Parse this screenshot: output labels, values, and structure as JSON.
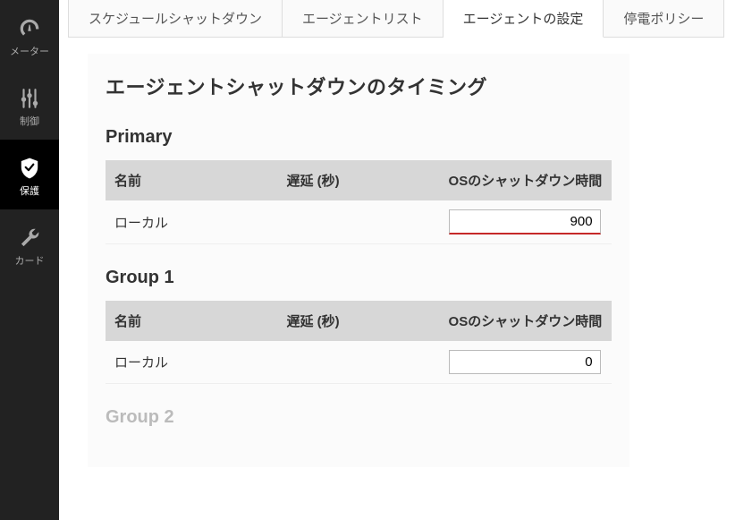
{
  "sidebar": {
    "items": [
      {
        "label": "メーター",
        "name": "sidebar-item-meter",
        "icon": "gauge-icon",
        "active": false
      },
      {
        "label": "制御",
        "name": "sidebar-item-control",
        "icon": "sliders-icon",
        "active": false
      },
      {
        "label": "保護",
        "name": "sidebar-item-protect",
        "icon": "shield-icon",
        "active": true
      },
      {
        "label": "カード",
        "name": "sidebar-item-card",
        "icon": "wrench-icon",
        "active": false
      }
    ]
  },
  "tabs": [
    {
      "label": "スケジュールシャットダウン",
      "name": "tab-scheduled-shutdown",
      "active": false
    },
    {
      "label": "エージェントリスト",
      "name": "tab-agent-list",
      "active": false
    },
    {
      "label": "エージェントの設定",
      "name": "tab-agent-settings",
      "active": true
    },
    {
      "label": "停電ポリシー",
      "name": "tab-outage-policy",
      "active": false
    }
  ],
  "panel": {
    "title": "エージェントシャットダウンのタイミング",
    "columns": {
      "name": "名前",
      "delay": "遅延 (秒)",
      "os": "OSのシャットダウン時間"
    },
    "sections": [
      {
        "title": "Primary",
        "dim": false,
        "rows": [
          {
            "name": "ローカル",
            "delay": "",
            "os": "900",
            "dirty": true
          }
        ]
      },
      {
        "title": "Group 1",
        "dim": false,
        "rows": [
          {
            "name": "ローカル",
            "delay": "",
            "os": "0",
            "dirty": false
          }
        ]
      },
      {
        "title": "Group 2",
        "dim": true,
        "rows": []
      }
    ]
  }
}
